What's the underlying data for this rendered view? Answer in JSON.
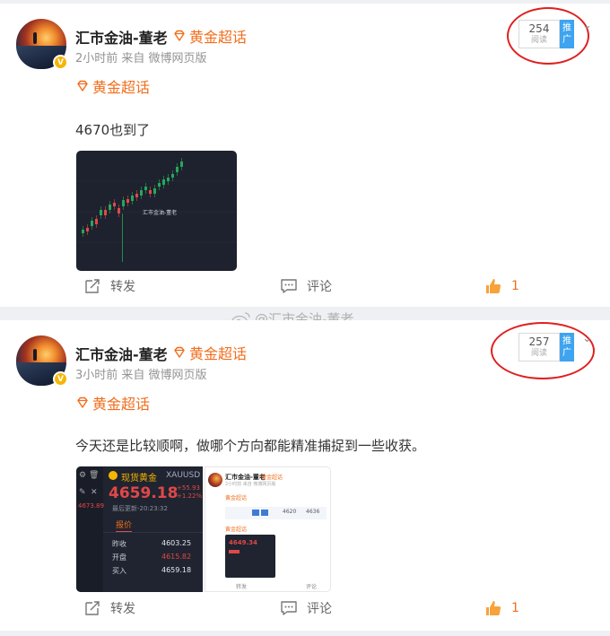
{
  "posts": [
    {
      "author": "汇市金油-董老",
      "badge": "黄金超话",
      "meta": "2小时前  来自 微博网页版",
      "topic": "黄金超话",
      "read_count": "254",
      "read_label": "阅读",
      "promote_label": "推广",
      "content": "4670也到了",
      "chart_watermark": "汇市金油-董老",
      "actions": {
        "repost": "转发",
        "comment": "评论",
        "like_count": "1"
      }
    },
    {
      "author": "汇市金油-董老",
      "badge": "黄金超话",
      "meta": "3小时前  来自 微博网页版",
      "topic": "黄金超话",
      "read_count": "257",
      "read_label": "阅读",
      "promote_label": "推广",
      "content": "今天还是比较顺啊，做哪个方向都能精准捕捉到一些收获。",
      "quote": {
        "symbol_name": "现货黄金",
        "symbol_code": "XAUUSD",
        "price": "4659.18",
        "change": "+55.93",
        "change_pct": "+1.22%",
        "updated": "最后更新-20:23:32",
        "side_price": "4673.89",
        "tab": "报价",
        "rows": [
          {
            "label": "昨收",
            "value": "4603.25"
          },
          {
            "label": "开盘",
            "value": "4615.82"
          },
          {
            "label": "买入",
            "value": "4659.18"
          }
        ]
      },
      "shot": {
        "author": "汇市金油-董老",
        "badge": "黄金超话",
        "meta": "2小时前 来自 微博网页版",
        "topic": "黄金超话",
        "bar_values": [
          "4620",
          "4636"
        ],
        "price": "4649.34",
        "action_left": "转发",
        "action_right": "评论"
      },
      "actions": {
        "repost": "转发",
        "comment": "评论",
        "like_count": "1"
      }
    }
  ],
  "watermark": "@汇市金油-董老",
  "colors": {
    "brand_orange": "#f26d1b",
    "annotation_red": "#e02020",
    "promote_blue": "#3ea4f0",
    "up_green": "#26a65b",
    "down_red": "#e04848"
  }
}
